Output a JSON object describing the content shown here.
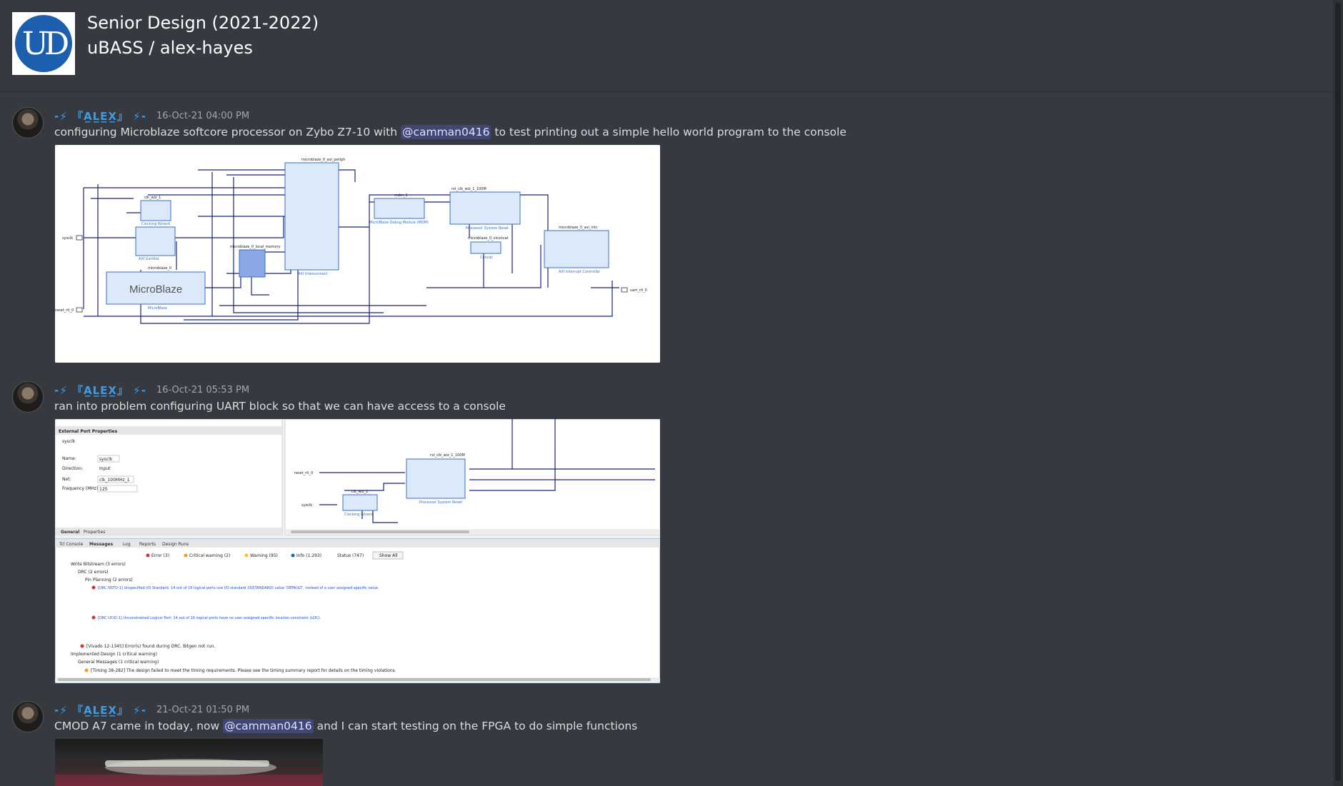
{
  "header": {
    "server_name": "Senior Design (2021-2022)",
    "channel_name": "uBASS / alex-hayes",
    "logo_text": "UD"
  },
  "messages": [
    {
      "username": "-⚡ 『A̲L̲E̲X̲』 ⚡-",
      "timestamp": "16-Oct-21 04:00 PM",
      "text_before": "configuring Microblaze softcore processor on Zybo Z7-10 with ",
      "mention": "@camman0416",
      "text_after": " to test printing out a simple hello world program to the console",
      "attachment": "block-design-diagram"
    },
    {
      "username": "-⚡ 『A̲L̲E̲X̲』 ⚡-",
      "timestamp": "16-Oct-21 05:53 PM",
      "text": "ran into problem configuring UART block so that we can have access to a console",
      "attachment": "vivado-screenshot"
    },
    {
      "username": "-⚡ 『A̲L̲E̲X̲』 ⚡-",
      "timestamp": "21-Oct-21 01:50 PM",
      "text_before": "CMOD A7 came in today, now ",
      "mention": "@camman0416",
      "text_after": " and I can start testing on the FPGA to do simple functions",
      "attachment": "fpga-photo"
    }
  ],
  "diagram": {
    "blocks": [
      "clk_wiz_1",
      "Clocking Wizard",
      "axi_uartlite_0",
      "AXI Uartlite",
      "microblaze_0_axi_periph",
      "AXI Interconnect",
      "mdm_1",
      "MicroBlaze Debug Module (MDM)",
      "rst_clk_wiz_1_100M",
      "Processor System Reset",
      "microblaze_0_xlconcat",
      "Concat",
      "microblaze_0_axi_intc",
      "AXI Interrupt Controller",
      "microblaze_0",
      "MicroBlaze",
      "microblaze_0_local_memory"
    ],
    "ports": [
      "sysclk",
      "reset_rtl_0",
      "uart_rtl_0"
    ],
    "microblaze_logo": "MicroBlaze"
  },
  "vivado": {
    "panel_title": "External Port Properties",
    "port_name": "sysclk",
    "name_label": "Name:",
    "name_value": "sysclk",
    "direction_label": "Direction:",
    "direction_value": "Input",
    "net_label": "Net:",
    "net_value": "clk_100MHz_1",
    "freq_label": "Frequency (MHz):",
    "freq_value": "125",
    "tabs_left": [
      "General",
      "Properties"
    ],
    "console_tabs": [
      "Tcl Console",
      "Messages",
      "Log",
      "Reports",
      "Design Runs"
    ],
    "filters": [
      "Error (3)",
      "Critical warning (2)",
      "Warning (95)",
      "Info (1,293)",
      "Status (747)"
    ],
    "show_all": "Show All",
    "tree": [
      "Write Bitstream (3 errors)",
      "DRC (2 errors)",
      "Pin Planning (2 errors)",
      "[DRC NSTD-1] Unspecified I/O Standard: 14 out of 16 logical ports use I/O standard (IOSTANDARD) value 'DEFAULT', instead of a user assigned specific value.",
      "[DRC UCIO-1] Unconstrained Logical Port: 14 out of 16 logical ports have no user assigned specific location constraint (LOC).",
      "[Vivado 12-1345] Error(s) found during DRC. Bitgen not run.",
      "Implemented Design (1 critical warning)",
      "General Messages (1 critical warning)",
      "[Timing 38-282] The design failed to meet the timing requirements. Please see the timing summary report for details on the timing violations."
    ],
    "schematic_ports": [
      "reset_rtl_0",
      "sysclk"
    ],
    "schematic_blocks": [
      "rst_clk_wiz_1_100M",
      "Processor System Reset",
      "clk_wiz_1",
      "Clocking Wizard"
    ]
  }
}
